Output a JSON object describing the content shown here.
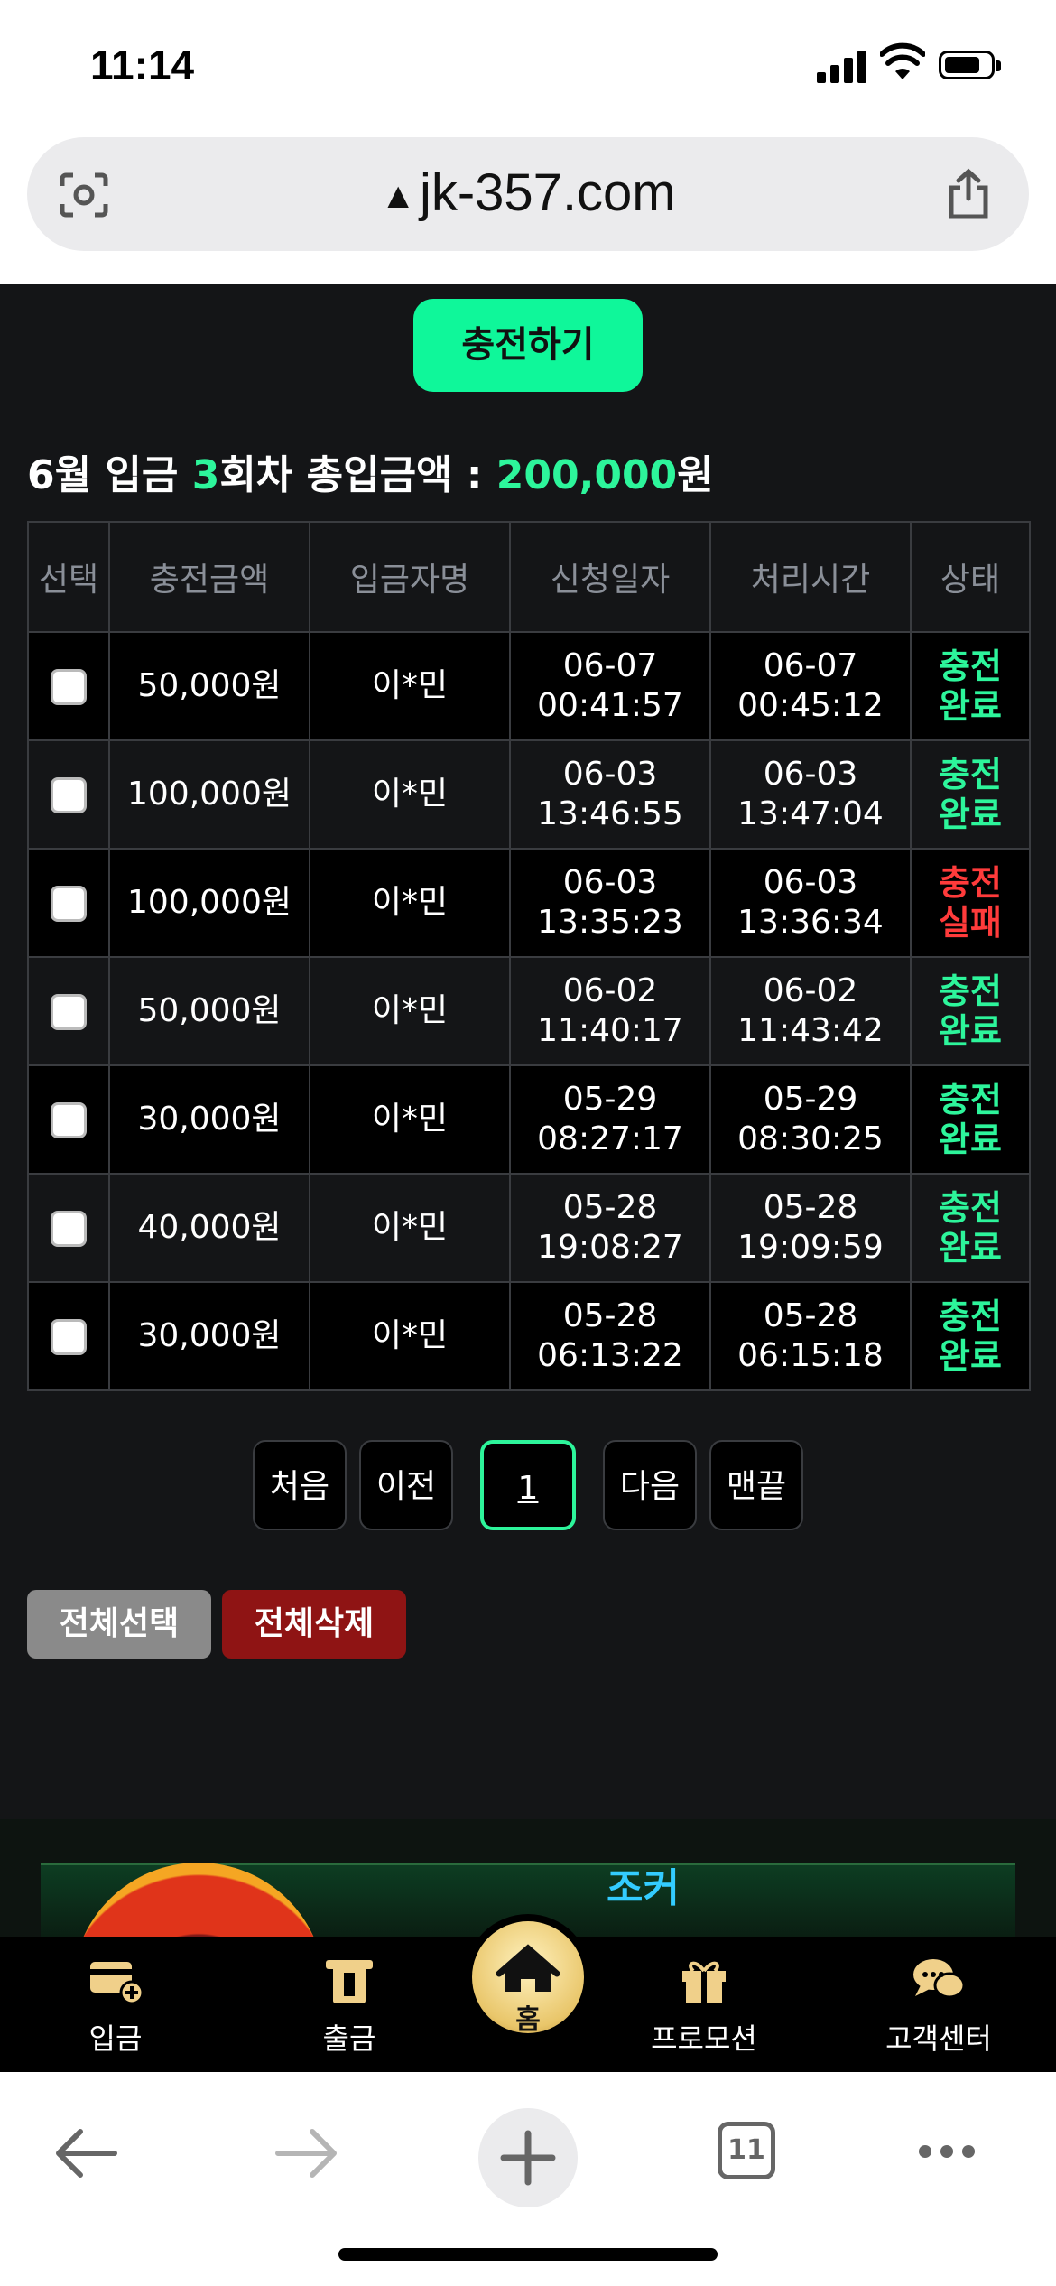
{
  "status_bar": {
    "time": "11:14"
  },
  "browser": {
    "url": "jk-357.com",
    "tabs_count": "11"
  },
  "charge_button": "충전하기",
  "summary": {
    "prefix": "6월 입금 ",
    "count": "3",
    "middle": "회차 총입금액 : ",
    "amount": "200,000",
    "unit": "원"
  },
  "table": {
    "headers": [
      "선택",
      "충전금액",
      "입금자명",
      "신청일자",
      "처리시간",
      "상태"
    ],
    "rows": [
      {
        "amount": "50,000원",
        "name": "이*민",
        "req_date": "06-07",
        "req_time": "00:41:57",
        "proc_date": "06-07",
        "proc_time": "00:45:12",
        "status1": "충전",
        "status2": "완료",
        "status_type": "ok"
      },
      {
        "amount": "100,000원",
        "name": "이*민",
        "req_date": "06-03",
        "req_time": "13:46:55",
        "proc_date": "06-03",
        "proc_time": "13:47:04",
        "status1": "충전",
        "status2": "완료",
        "status_type": "ok"
      },
      {
        "amount": "100,000원",
        "name": "이*민",
        "req_date": "06-03",
        "req_time": "13:35:23",
        "proc_date": "06-03",
        "proc_time": "13:36:34",
        "status1": "충전",
        "status2": "실패",
        "status_type": "fail"
      },
      {
        "amount": "50,000원",
        "name": "이*민",
        "req_date": "06-02",
        "req_time": "11:40:17",
        "proc_date": "06-02",
        "proc_time": "11:43:42",
        "status1": "충전",
        "status2": "완료",
        "status_type": "ok"
      },
      {
        "amount": "30,000원",
        "name": "이*민",
        "req_date": "05-29",
        "req_time": "08:27:17",
        "proc_date": "05-29",
        "proc_time": "08:30:25",
        "status1": "충전",
        "status2": "완료",
        "status_type": "ok"
      },
      {
        "amount": "40,000원",
        "name": "이*민",
        "req_date": "05-28",
        "req_time": "19:08:27",
        "proc_date": "05-28",
        "proc_time": "19:09:59",
        "status1": "충전",
        "status2": "완료",
        "status_type": "ok"
      },
      {
        "amount": "30,000원",
        "name": "이*민",
        "req_date": "05-28",
        "req_time": "06:13:22",
        "proc_date": "05-28",
        "proc_time": "06:15:18",
        "status1": "충전",
        "status2": "완료",
        "status_type": "ok"
      }
    ]
  },
  "pagination": {
    "first": "처음",
    "prev": "이전",
    "current": "1",
    "next": "다음",
    "last": "맨끝"
  },
  "actions": {
    "select_all": "전체선택",
    "delete_all": "전체삭제"
  },
  "banner": {
    "mascot_text": "조커"
  },
  "tabbar": {
    "deposit": "입금",
    "withdraw": "출금",
    "home": "홈",
    "promotion": "프로모션",
    "support": "고객센터"
  },
  "colors": {
    "accent_green": "#0ff79a",
    "status_ok": "#2df59b",
    "status_fail": "#ff3b3b",
    "delete_red": "#8f1414"
  }
}
